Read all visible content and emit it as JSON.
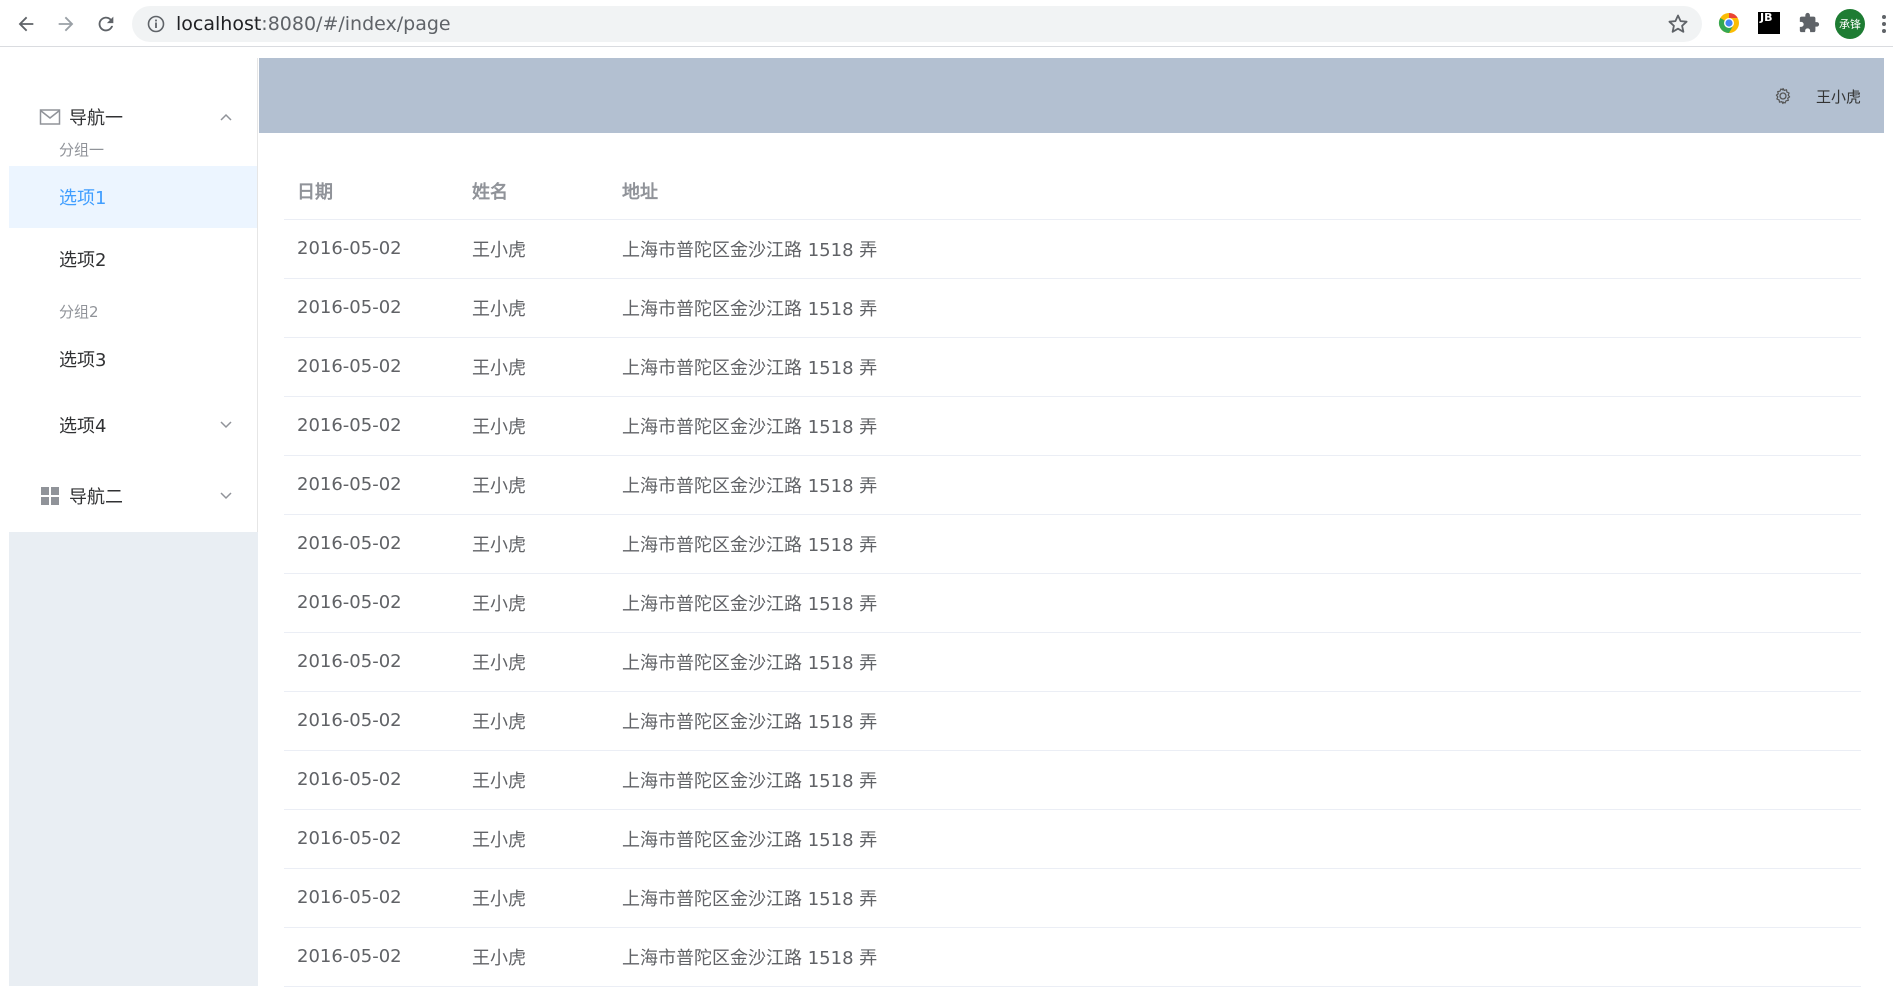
{
  "browser": {
    "url_host": "localhost",
    "url_path": ":8080/#/index/page",
    "profile_initials": "承锋",
    "jb_label": "JB"
  },
  "sidebar": {
    "nav1": {
      "label": "导航一",
      "groups": [
        {
          "title": "分组一",
          "items": [
            {
              "label": "选项1",
              "active": true
            },
            {
              "label": "选项2",
              "active": false
            }
          ]
        },
        {
          "title": "分组2",
          "items": [
            {
              "label": "选项3",
              "active": false
            }
          ]
        }
      ],
      "submenu": {
        "label": "选项4"
      }
    },
    "nav2": {
      "label": "导航二"
    }
  },
  "header": {
    "username": "王小虎"
  },
  "table": {
    "columns": [
      "日期",
      "姓名",
      "地址"
    ],
    "rows": [
      [
        "2016-05-02",
        "王小虎",
        "上海市普陀区金沙江路 1518 弄"
      ],
      [
        "2016-05-02",
        "王小虎",
        "上海市普陀区金沙江路 1518 弄"
      ],
      [
        "2016-05-02",
        "王小虎",
        "上海市普陀区金沙江路 1518 弄"
      ],
      [
        "2016-05-02",
        "王小虎",
        "上海市普陀区金沙江路 1518 弄"
      ],
      [
        "2016-05-02",
        "王小虎",
        "上海市普陀区金沙江路 1518 弄"
      ],
      [
        "2016-05-02",
        "王小虎",
        "上海市普陀区金沙江路 1518 弄"
      ],
      [
        "2016-05-02",
        "王小虎",
        "上海市普陀区金沙江路 1518 弄"
      ],
      [
        "2016-05-02",
        "王小虎",
        "上海市普陀区金沙江路 1518 弄"
      ],
      [
        "2016-05-02",
        "王小虎",
        "上海市普陀区金沙江路 1518 弄"
      ],
      [
        "2016-05-02",
        "王小虎",
        "上海市普陀区金沙江路 1518 弄"
      ],
      [
        "2016-05-02",
        "王小虎",
        "上海市普陀区金沙江路 1518 弄"
      ],
      [
        "2016-05-02",
        "王小虎",
        "上海市普陀区金沙江路 1518 弄"
      ],
      [
        "2016-05-02",
        "王小虎",
        "上海市普陀区金沙江路 1518 弄"
      ]
    ]
  },
  "colors": {
    "accent": "#409eff",
    "header_bg": "#b3c0d1",
    "aside_bg": "#e9eef3",
    "active_item_bg": "#ecf5ff"
  },
  "icons": {
    "back": "arrow-left-icon",
    "forward": "arrow-right-icon",
    "reload": "reload-icon",
    "info": "info-icon",
    "bookmark": "star-icon",
    "extensions": "puzzle-icon",
    "nav1": "message-icon",
    "nav2": "menu-grid-icon",
    "settings": "setting-icon"
  }
}
